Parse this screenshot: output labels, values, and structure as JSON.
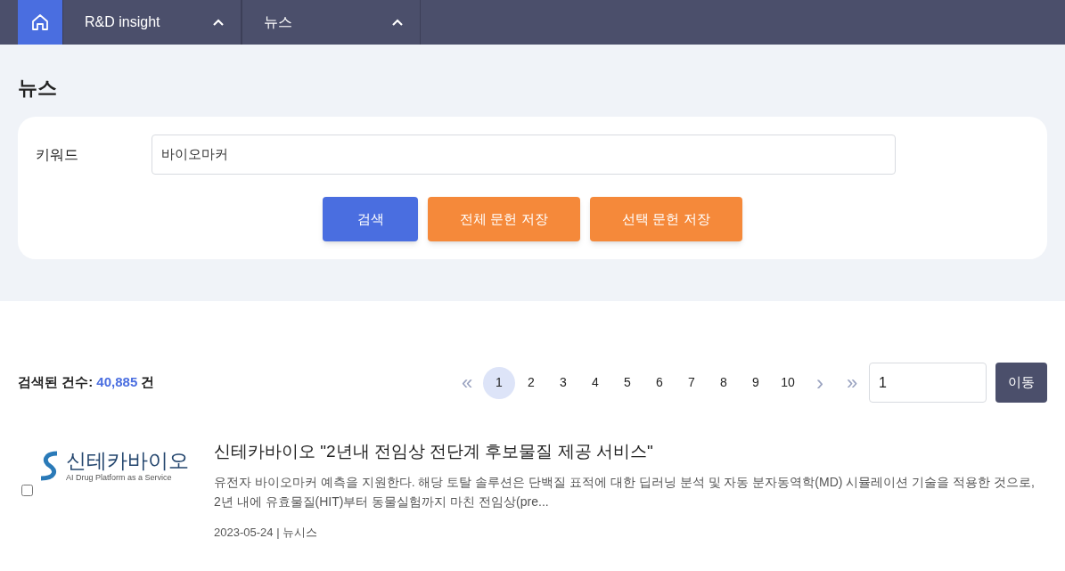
{
  "nav": {
    "home": {
      "selected": true
    },
    "menus": [
      {
        "label": "R&D insight",
        "expanded": true
      },
      {
        "label": "뉴스",
        "expanded": true
      }
    ]
  },
  "page_title": "뉴스",
  "search": {
    "label": "키워드",
    "value": "바이오마커",
    "buttons": [
      {
        "label": "검색",
        "kind": "primary"
      },
      {
        "label": "전체 문헌 저장",
        "kind": "secondary"
      },
      {
        "label": "선택 문헌 저장",
        "kind": "secondary"
      }
    ]
  },
  "result_count": {
    "label": "검색된 건수:",
    "count": "40,885",
    "unit": "건"
  },
  "pagination": {
    "first": "«",
    "next": "›",
    "last": "»",
    "pages": [
      {
        "label": "1",
        "selected": true
      },
      {
        "label": "2",
        "selected": false
      },
      {
        "label": "3",
        "selected": false
      },
      {
        "label": "4",
        "selected": false
      },
      {
        "label": "5",
        "selected": false
      },
      {
        "label": "6",
        "selected": false
      },
      {
        "label": "7",
        "selected": false
      },
      {
        "label": "8",
        "selected": false
      },
      {
        "label": "9",
        "selected": false
      },
      {
        "label": "10",
        "selected": false
      }
    ],
    "goto_value": "1",
    "goto_button": "이동"
  },
  "articles": [
    {
      "checked": false,
      "logo": {
        "name": "신테카바이오",
        "tagline": "AI Drug Platform as a Service"
      },
      "title": "신테카바이오 \"2년내 전임상 전단계 후보물질 제공 서비스\"",
      "summary": "유전자 바이오마커 예측을 지원한다. 해당 토탈 솔루션은 단백질 표적에 대한 딥러닝 분석 및 자동 분자동역학(MD) 시뮬레이션 기술을 적용한 것으로, 2년 내에 유효물질(HIT)부터 동물실험까지 마친 전임상(pre...",
      "date": "2023-05-24",
      "separator": "|",
      "source": "뉴시스"
    }
  ]
}
